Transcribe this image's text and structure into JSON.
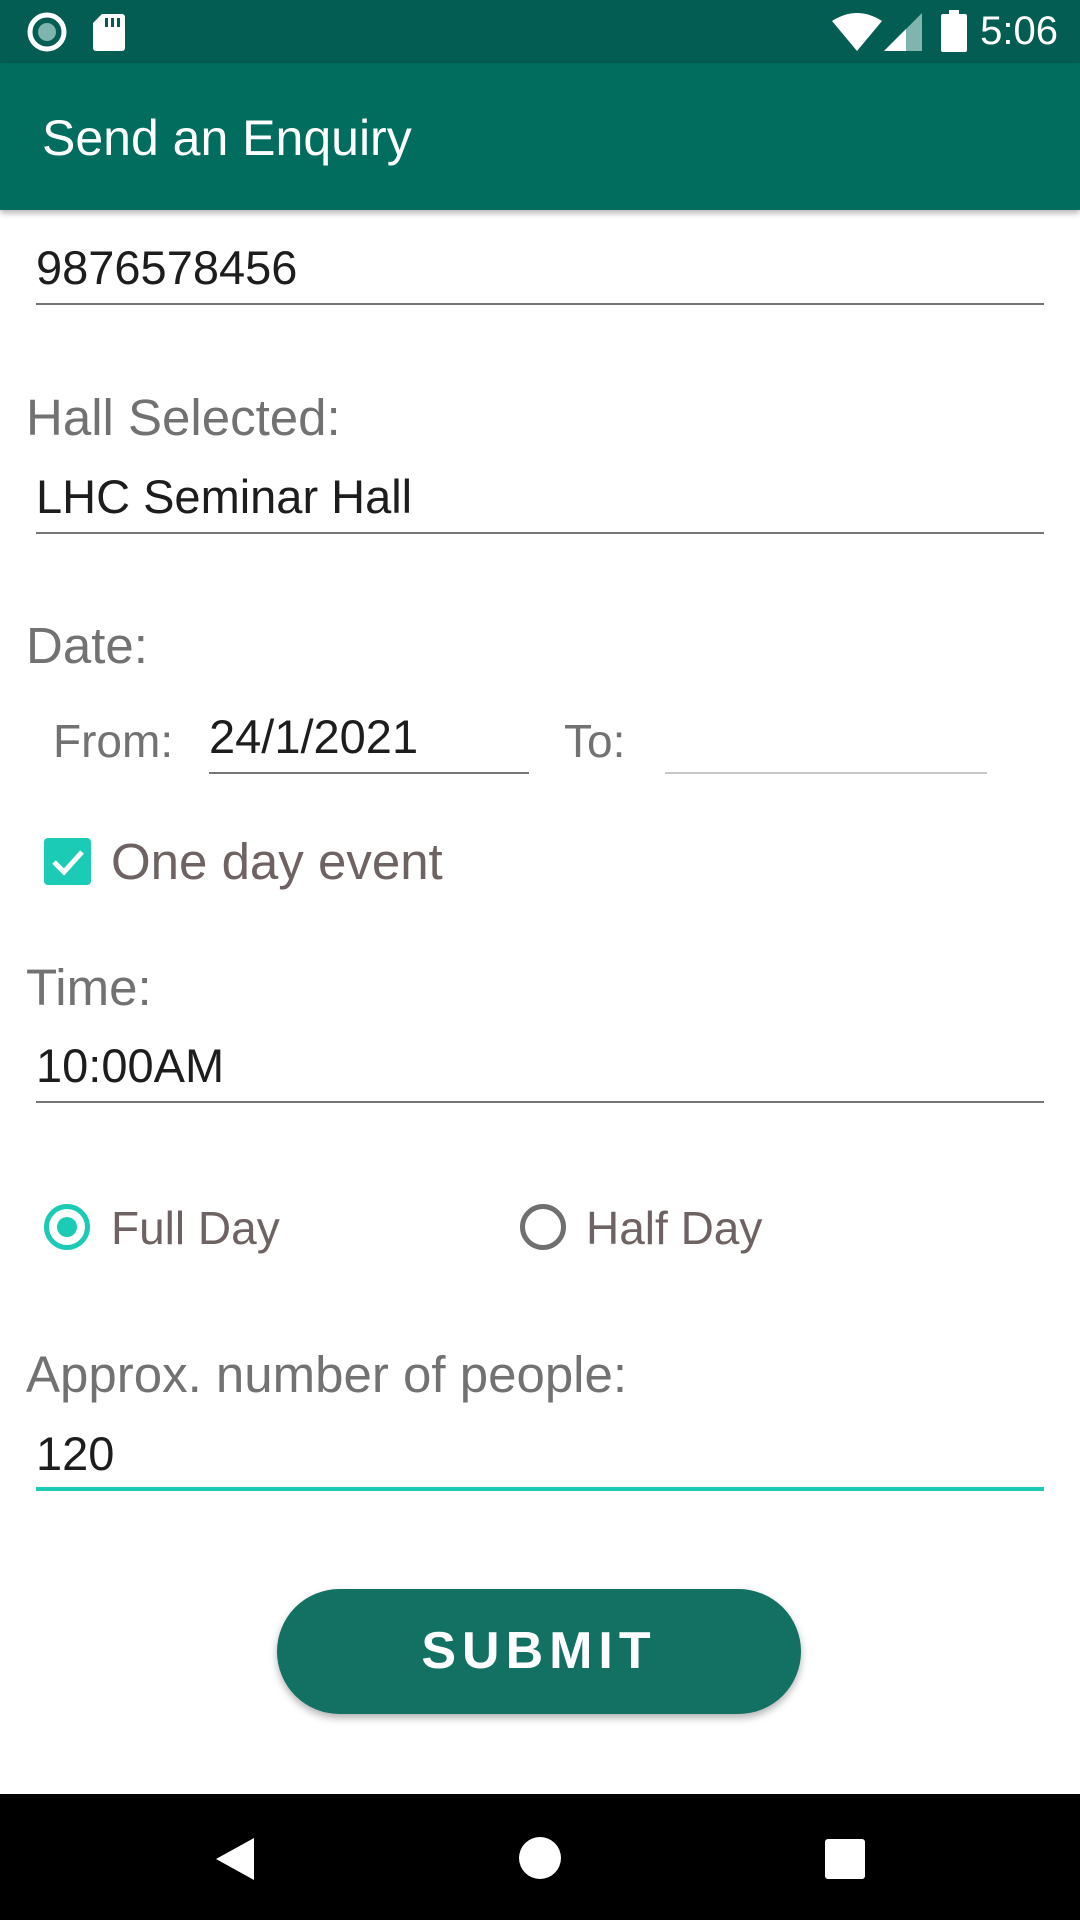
{
  "status_bar": {
    "time": "5:06",
    "icons": [
      "record-icon",
      "sd-card-icon",
      "wifi-icon",
      "signal-icon",
      "battery-icon"
    ]
  },
  "app_bar": {
    "title": "Send an Enquiry"
  },
  "form": {
    "phone_value": "9876578456",
    "hall_label": "Hall Selected:",
    "hall_value": "LHC Seminar Hall",
    "date_label": "Date:",
    "from_label": "From:",
    "from_value": "24/1/2021",
    "to_label": "To:",
    "to_value": "",
    "one_day_label": "One day event",
    "one_day_checked": true,
    "time_label": "Time:",
    "time_value": "10:00AM",
    "full_day_label": "Full Day",
    "half_day_label": "Half Day",
    "selected_duration": "Full Day",
    "people_label": "Approx. number of people:",
    "people_value": "120",
    "submit_label": "SUBMIT"
  },
  "colors": {
    "status_bar": "#045d52",
    "app_bar": "#016d5e",
    "accent": "#1ccbb5",
    "button": "#127163"
  }
}
